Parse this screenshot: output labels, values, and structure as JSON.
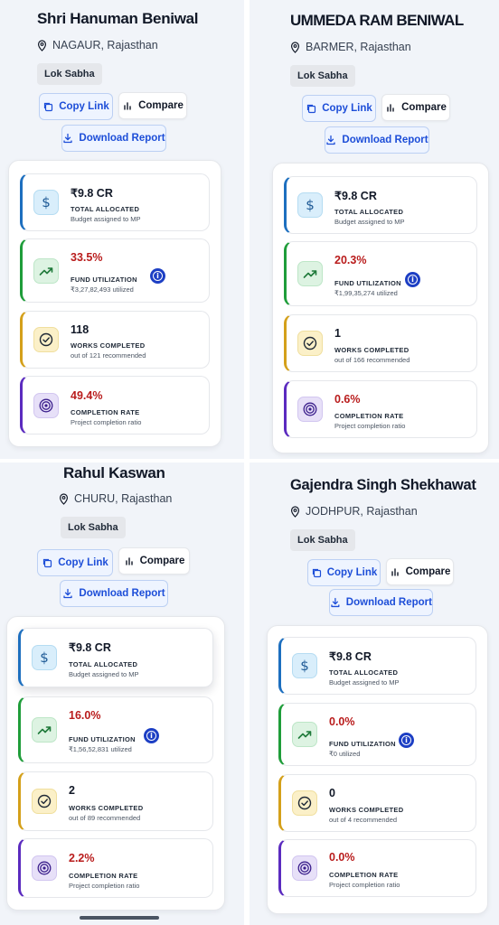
{
  "labels": {
    "copy_link": "Copy Link",
    "compare": "Compare",
    "download_report": "Download Report",
    "total_allocated": "TOTAL ALLOCATED",
    "budget_assigned": "Budget assigned to MP",
    "fund_utilization": "FUND UTILIZATION",
    "works_completed": "WORKS COMPLETED",
    "completion_rate": "COMPLETION RATE",
    "project_completion_ratio": "Project completion ratio",
    "info_glyph": "i"
  },
  "colors": {
    "accent_blue": "#1d4ed8",
    "value_red": "#b91c1c",
    "allocated_bar": "#1d6fbf",
    "utilization_bar": "#1f9d3a",
    "works_bar": "#d4a01a",
    "rate_bar": "#5b2bbf"
  },
  "icons": {
    "location": "map-pin-icon",
    "copy": "copy-icon",
    "compare": "bar-chart-icon",
    "download": "download-icon",
    "allocated": "dollar-icon",
    "utilization": "trending-up-icon",
    "works": "check-circle-icon",
    "rate": "target-icon",
    "info": "info-icon"
  },
  "mps": [
    {
      "name": "Shri Hanuman Beniwal",
      "location": "NAGAUR, Rajasthan",
      "house": "Lok Sabha",
      "allocated": "₹9.8 CR",
      "utilization_pct": "33.5%",
      "utilized_amount": "₹3,27,82,493 utilized",
      "works_completed": "118",
      "works_sub": "out of 121 recommended",
      "completion_rate": "49.4%"
    },
    {
      "name": "UMMEDA RAM BENIWAL",
      "location": "BARMER, Rajasthan",
      "house": "Lok Sabha",
      "allocated": "₹9.8 CR",
      "utilization_pct": "20.3%",
      "utilized_amount": "₹1,99,35,274 utilized",
      "works_completed": "1",
      "works_sub": "out of 166 recommended",
      "completion_rate": "0.6%"
    },
    {
      "name": "Rahul Kaswan",
      "location": "CHURU, Rajasthan",
      "house": "Lok Sabha",
      "allocated": "₹9.8 CR",
      "utilization_pct": "16.0%",
      "utilized_amount": "₹1,56,52,831 utilized",
      "works_completed": "2",
      "works_sub": "out of 89 recommended",
      "completion_rate": "2.2%"
    },
    {
      "name": "Gajendra Singh Shekhawat",
      "location": "JODHPUR, Rajasthan",
      "house": "Lok Sabha",
      "allocated": "₹9.8 CR",
      "utilization_pct": "0.0%",
      "utilized_amount": "₹0 utilized",
      "works_completed": "0",
      "works_sub": "out of 4 recommended",
      "completion_rate": "0.0%"
    }
  ]
}
